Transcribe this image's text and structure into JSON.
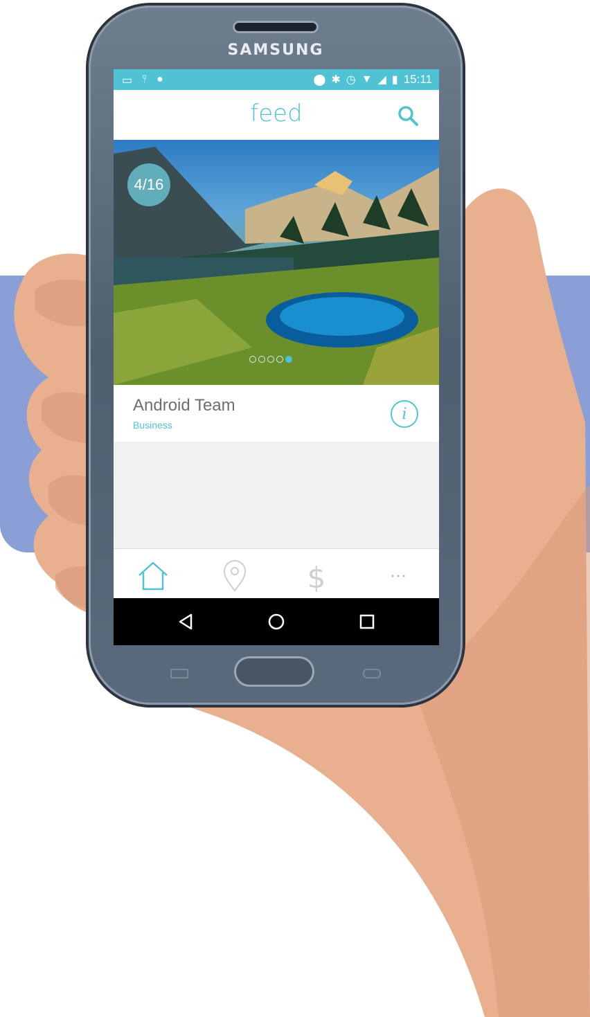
{
  "device": {
    "brand": "SAMSUNG"
  },
  "statusbar": {
    "time": "15:11"
  },
  "appbar": {
    "title": "feed"
  },
  "hero": {
    "counter": "4/16",
    "dots_total": 5,
    "dots_active_index": 4
  },
  "card": {
    "title": "Android Team",
    "subtitle": "Business"
  },
  "bottom_nav": {
    "items": [
      "home-icon",
      "location-pin-icon",
      "dollar-icon",
      "more-icon"
    ],
    "active_index": 0
  },
  "colors": {
    "accent": "#4fc3d4",
    "background_panel": "#8a9fd6"
  }
}
